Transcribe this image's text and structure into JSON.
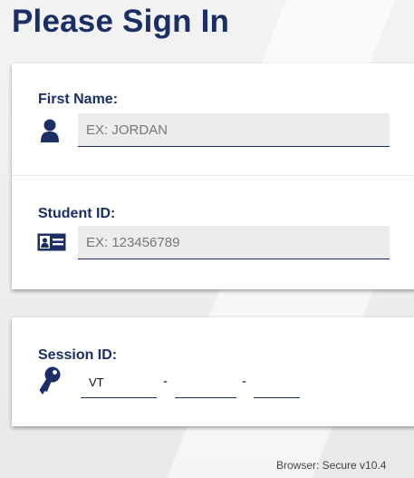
{
  "page": {
    "title": "Please Sign In"
  },
  "first_name": {
    "label": "First Name:",
    "placeholder": "EX: JORDAN",
    "value": ""
  },
  "student_id": {
    "label": "Student ID:",
    "placeholder": "EX: 123456789",
    "value": ""
  },
  "session_id": {
    "label": "Session ID:",
    "part1": "VT",
    "separator": "-",
    "part2": "",
    "part3": ""
  },
  "footer": {
    "browser_text": "Browser: Secure v10.4"
  },
  "icons": {
    "first_name": "user-icon",
    "student_id": "id-card-icon",
    "session_id": "key-icon"
  },
  "colors": {
    "accent": "#1b2f66",
    "field_bg": "#ececec",
    "card_bg": "#ffffff"
  }
}
